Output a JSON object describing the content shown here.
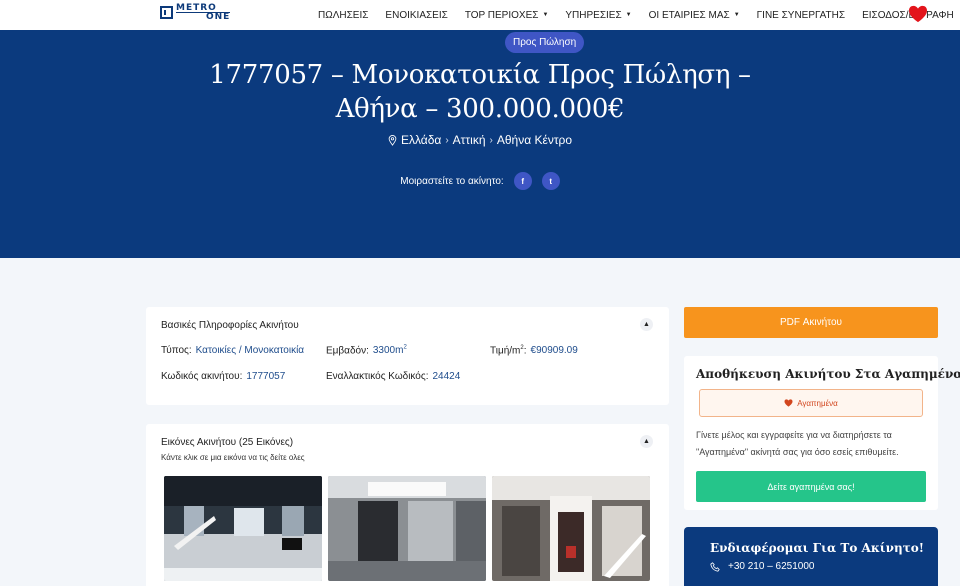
{
  "nav": {
    "logo_top": "METRO",
    "logo_bottom": "ONE",
    "items": [
      {
        "label": "ΠΩΛΗΣΕΙΣ",
        "caret": false
      },
      {
        "label": "ΕΝΟΙΚΙΑΣΕΙΣ",
        "caret": false
      },
      {
        "label": "TOP ΠΕΡΙΟΧΕΣ",
        "caret": true
      },
      {
        "label": "ΥΠΗΡΕΣΙΕΣ",
        "caret": true
      },
      {
        "label": "ΟΙ ΕΤΑΙΡΙΕΣ ΜΑΣ",
        "caret": true
      },
      {
        "label": "ΓΙΝΕ ΣΥΝΕΡΓΑΤΗΣ",
        "caret": false
      },
      {
        "label": "ΕΙΣΟΔΟΣ/ΕΓΓΡΑΦΗ",
        "caret": false
      }
    ],
    "favorites_icon": "heart-icon",
    "heart_color": "#e3141b"
  },
  "hero": {
    "badge": "Προς Πώληση",
    "title": "1777057 – Μονοκατοικία Προς Πώληση – Αθήνα – 300.000.000€",
    "location": {
      "country": "Ελλάδα",
      "region": "Αττική",
      "area": "Αθήνα Κέντρο"
    },
    "share_label": "Μοιραστείτε το ακίνητο:",
    "share_buttons": [
      {
        "icon": "facebook-icon",
        "glyph": "f"
      },
      {
        "icon": "twitter-icon",
        "glyph": "t"
      }
    ],
    "bg_color": "#0b3a7e"
  },
  "basic_info": {
    "title": "Βασικές Πληροφορίες Ακινήτου",
    "type_label": "Τύπος:",
    "type_value": "Κατοικίες / Μονοκατοικία",
    "area_label": "Εμβαδόν:",
    "area_value": "3300m",
    "area_unit_sup": "2",
    "price_sqm_label": "Τιμή/m",
    "price_sqm_sup": "2",
    "price_sqm_colon": ":",
    "price_sqm_value": "€90909.09",
    "code_label": "Κωδικός ακινήτου:",
    "code_value": "1777057",
    "alt_code_label": "Εναλλακτικός Κωδικός:",
    "alt_code_value": "24424"
  },
  "images": {
    "title": "Εικόνες Ακινήτου (25 Εικόνες)",
    "subtitle": "Κάντε κλικ σε μια εικόνα να τις δείτε ολες"
  },
  "sidebar": {
    "pdf_button": "PDF Ακινήτου",
    "pdf_color": "#f7941d",
    "fav_title": "Αποθήκευση Ακινήτου Στα Αγαπημένα",
    "fav_button": "Αγαπημένα",
    "fav_text": "Γίνετε μέλος και εγγραφείτε για να διατηρήσετε τα \"Αγαπημένα\" ακίνητά σας για όσο εσείς επιθυμείτε.",
    "fav_cta": "Δείτε αγαπημένα σας!",
    "cta_color": "#25c58a",
    "interest_title": "Ενδιαφέρομαι Για Το Ακίνητο!",
    "phone": "+30 210 – 6251000"
  }
}
